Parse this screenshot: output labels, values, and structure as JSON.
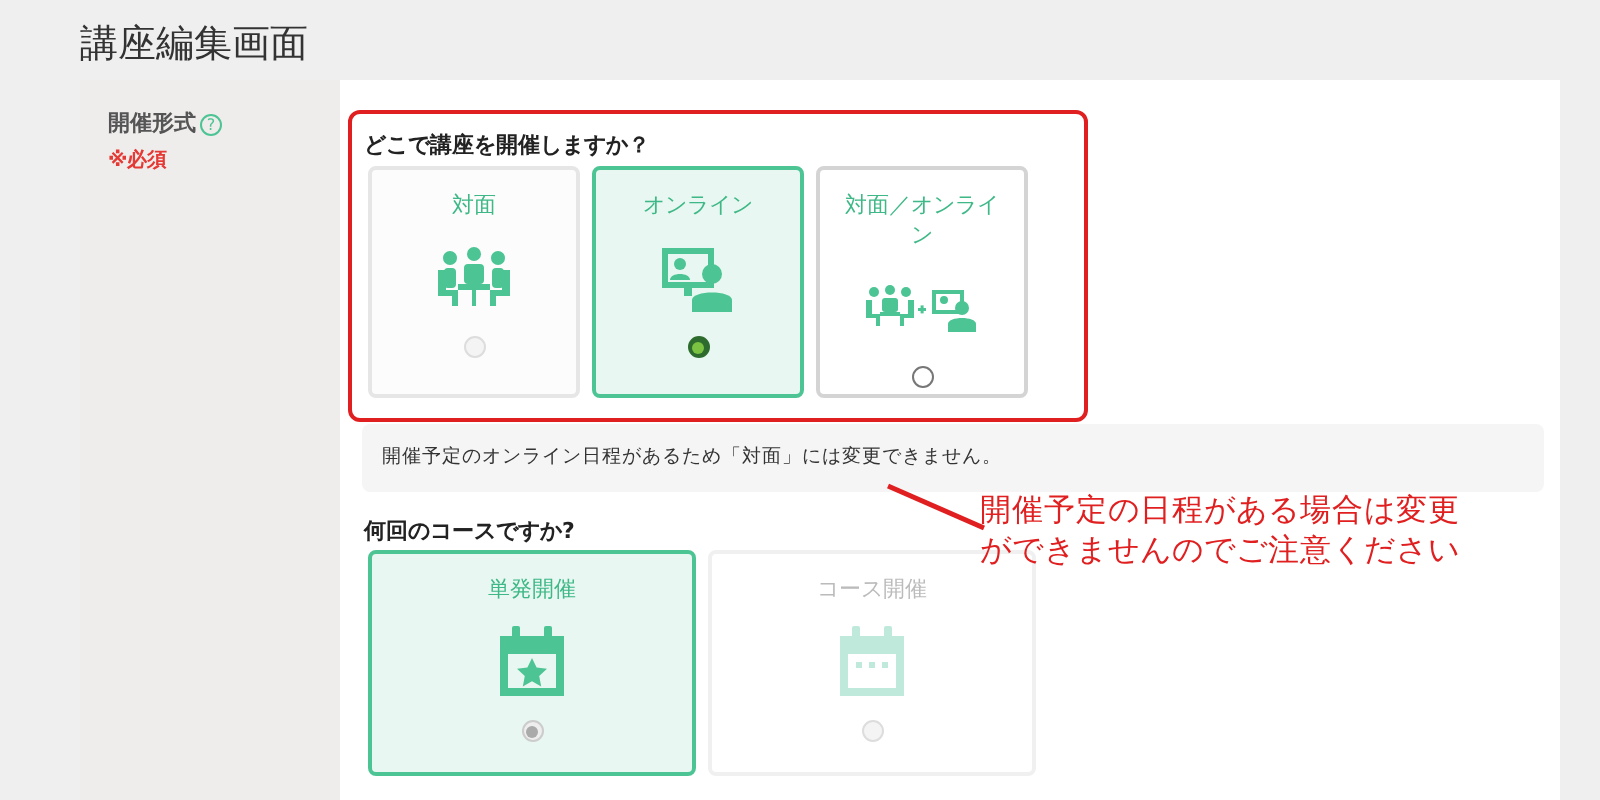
{
  "page_title": "講座編集画面",
  "field": {
    "label": "開催形式",
    "help": "?",
    "required": "※必須"
  },
  "venue": {
    "question": "どこで講座を開催しますか？",
    "options": [
      {
        "label": "対面",
        "selected": false,
        "disabled": true
      },
      {
        "label": "オンライン",
        "selected": true,
        "disabled": false
      },
      {
        "label": "対面／オンライン",
        "selected": false,
        "disabled": false
      }
    ]
  },
  "notice": "開催予定のオンライン日程があるため「対面」には変更できません。",
  "annotation": "開催予定の日程がある場合は変更ができませんのでご注意ください",
  "course": {
    "question": "何回のコースですか?",
    "options": [
      {
        "label": "単発開催",
        "selected": true,
        "disabled": true
      },
      {
        "label": "コース開催",
        "selected": false,
        "disabled": true
      }
    ]
  }
}
